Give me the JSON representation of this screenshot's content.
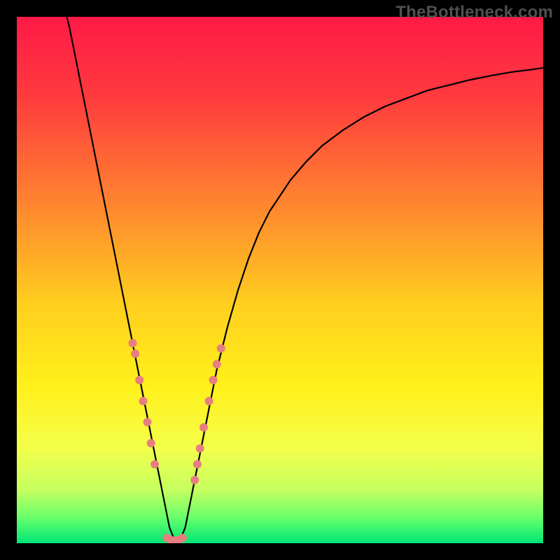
{
  "watermark": "TheBottleneck.com",
  "chart_data": {
    "type": "line",
    "title": "",
    "xlabel": "",
    "ylabel": "",
    "xlim": [
      0,
      100
    ],
    "ylim": [
      0,
      100
    ],
    "grid": false,
    "legend": false,
    "background_gradient": {
      "stops": [
        {
          "offset": 0.0,
          "color": "#ff1a47"
        },
        {
          "offset": 0.15,
          "color": "#ff3a3e"
        },
        {
          "offset": 0.35,
          "color": "#ff8330"
        },
        {
          "offset": 0.55,
          "color": "#ffd01e"
        },
        {
          "offset": 0.7,
          "color": "#fff01a"
        },
        {
          "offset": 0.82,
          "color": "#f4ff4a"
        },
        {
          "offset": 0.9,
          "color": "#c4ff60"
        },
        {
          "offset": 0.95,
          "color": "#6aff6a"
        },
        {
          "offset": 1.0,
          "color": "#00e676"
        }
      ]
    },
    "series": [
      {
        "name": "bottleneck-curve",
        "x": [
          9.5,
          10,
          11,
          12,
          13,
          14,
          15,
          16,
          17,
          18,
          19,
          20,
          21,
          22,
          23,
          24,
          25,
          26,
          27,
          28,
          29,
          30,
          31,
          32,
          33,
          34,
          35,
          36,
          37,
          38,
          40,
          42,
          44,
          46,
          48,
          50,
          52,
          55,
          58,
          62,
          66,
          70,
          74,
          78,
          82,
          86,
          90,
          94,
          98,
          100
        ],
        "y": [
          100,
          98,
          93,
          88,
          83,
          78,
          73,
          68,
          63,
          58,
          53,
          48,
          43,
          38,
          33,
          28,
          23,
          18,
          13,
          8,
          3,
          0.5,
          0.5,
          3,
          8,
          13,
          18,
          23,
          28,
          33,
          41,
          48,
          54,
          59,
          63,
          66,
          69,
          72.5,
          75.5,
          78.5,
          81,
          83,
          84.5,
          86,
          87,
          88,
          88.8,
          89.5,
          90,
          90.3
        ]
      }
    ],
    "scatter_points": {
      "name": "highlight-dots",
      "color": "#e77f80",
      "radius_px": 6,
      "points": [
        {
          "x": 22.0,
          "y": 38
        },
        {
          "x": 22.5,
          "y": 36
        },
        {
          "x": 23.3,
          "y": 31
        },
        {
          "x": 24.0,
          "y": 27
        },
        {
          "x": 24.8,
          "y": 23
        },
        {
          "x": 25.5,
          "y": 19
        },
        {
          "x": 26.2,
          "y": 15
        },
        {
          "x": 28.5,
          "y": 1.0
        },
        {
          "x": 29.3,
          "y": 0.6
        },
        {
          "x": 30.0,
          "y": 0.5
        },
        {
          "x": 30.7,
          "y": 0.6
        },
        {
          "x": 31.5,
          "y": 1.0
        },
        {
          "x": 33.8,
          "y": 12
        },
        {
          "x": 34.3,
          "y": 15
        },
        {
          "x": 34.8,
          "y": 18
        },
        {
          "x": 35.5,
          "y": 22
        },
        {
          "x": 36.5,
          "y": 27
        },
        {
          "x": 37.3,
          "y": 31
        },
        {
          "x": 38.0,
          "y": 34
        },
        {
          "x": 38.8,
          "y": 37
        }
      ]
    }
  }
}
